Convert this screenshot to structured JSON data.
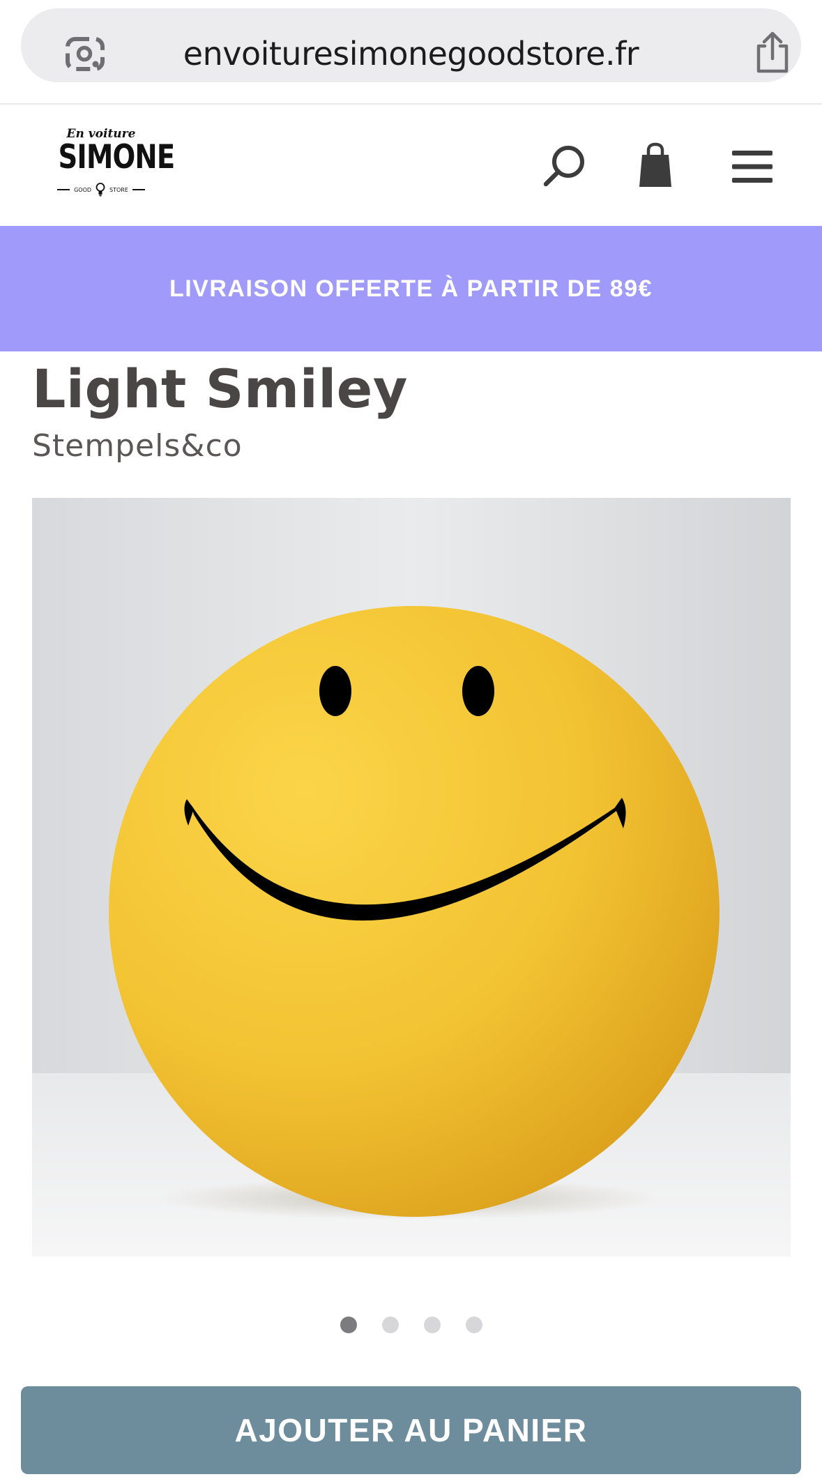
{
  "browser": {
    "url": "envoituresimonegoodstore.fr",
    "lens_icon": "visual-search-icon",
    "share_icon": "share-icon"
  },
  "header": {
    "logo": {
      "script_text": "En voiture",
      "main_text": "SIMONE",
      "left_word": "GOOD",
      "right_word": "STORE"
    },
    "icons": [
      "search-icon",
      "shopping-bag-icon",
      "hamburger-menu-icon"
    ]
  },
  "promo": {
    "text": "LIVRAISON OFFERTE À PARTIR DE 89€",
    "background": "#a09afa"
  },
  "product": {
    "title": "Light Smiley",
    "brand": "Stempels&co",
    "image": {
      "subject": "smiley-lamp",
      "colors": {
        "ball": "#f2c232",
        "face": "#000000",
        "background": "#e5e6e8"
      }
    },
    "carousel": {
      "total": 4,
      "active": 1
    },
    "add_to_cart_label": "AJOUTER AU PANIER",
    "button_color": "#6d8c9c"
  }
}
